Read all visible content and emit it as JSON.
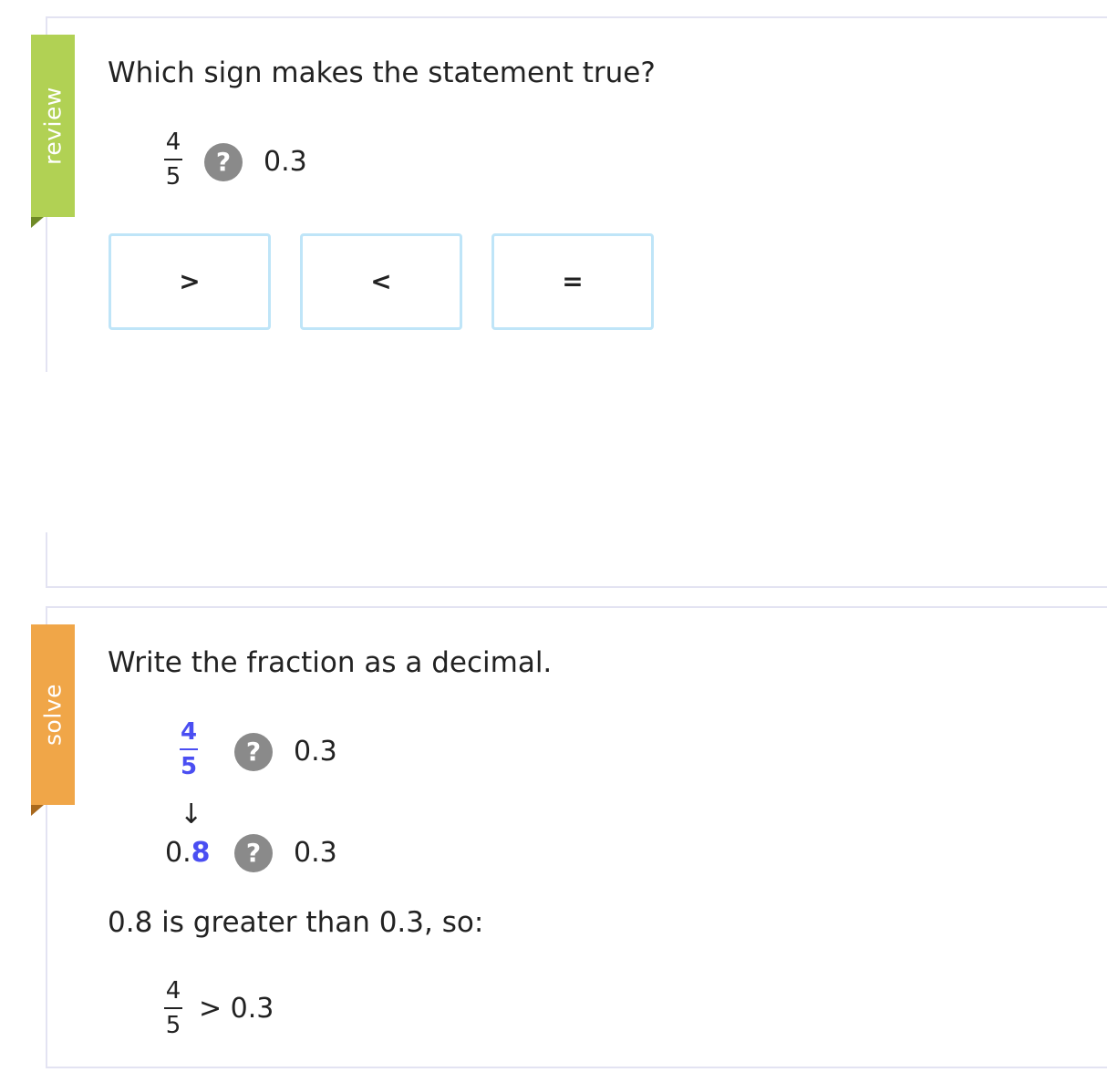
{
  "review": {
    "ribbon_label": "review",
    "question": "Which sign makes the statement true?",
    "fraction": {
      "numerator": "4",
      "denominator": "5"
    },
    "unknown_symbol": "?",
    "compare_value": "0.3",
    "choices": [
      ">",
      "<",
      "="
    ]
  },
  "solve": {
    "ribbon_label": "solve",
    "instruction": "Write the fraction as a decimal.",
    "fraction": {
      "numerator": "4",
      "denominator": "5"
    },
    "unknown_symbol": "?",
    "compare_value": "0.3",
    "arrow": "↓",
    "decimal_prefix": "0.",
    "decimal_digit": "8",
    "explanation": "0.8 is greater than 0.3, so:",
    "answer": {
      "fraction": {
        "numerator": "4",
        "denominator": "5"
      },
      "relation": "> 0.3"
    }
  },
  "colors": {
    "review_ribbon": "#b1d154",
    "solve_ribbon": "#f0a648",
    "highlight_blue": "#4a4ef2",
    "choice_border": "#bfe5f8",
    "question_badge": "#8a8a8a"
  }
}
